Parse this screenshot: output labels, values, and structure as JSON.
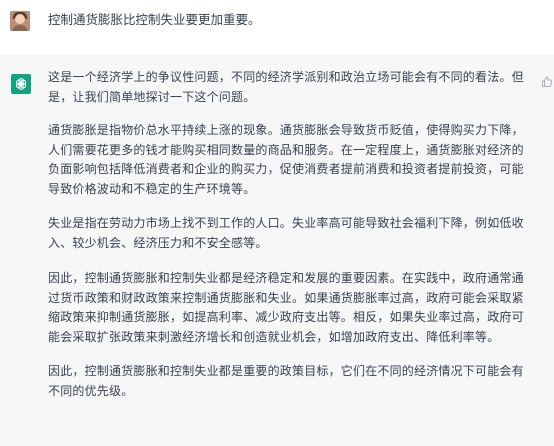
{
  "user_message": {
    "avatar": "user-avatar",
    "text": "控制通货膨胀比控制失业要更加重要。"
  },
  "assistant_message": {
    "avatar": "openai-logo-icon",
    "avatar_color": "#10a37f",
    "paragraphs": [
      "这是一个经济学上的争议性问题，不同的经济学派别和政治立场可能会有不同的看法。但是，让我们简单地探讨一下这个问题。",
      "通货膨胀是指物价总水平持续上涨的现象。通货膨胀会导致货币贬值，使得购买力下降，人们需要花更多的钱才能购买相同数量的商品和服务。在一定程度上，通货膨胀对经济的负面影响包括降低消费者和企业的购买力，促使消费者提前消费和投资者提前投资，可能导致价格波动和不稳定的生产环境等。",
      "失业是指在劳动力市场上找不到工作的人口。失业率高可能导致社会福利下降，例如低收入、较少机会、经济压力和不安全感等。",
      "因此，控制通货膨胀和控制失业都是经济稳定和发展的重要因素。在实践中，政府通常通过货币政策和财政政策来控制通货膨胀和失业。如果通货膨胀率过高，政府可能会采取紧缩政策来抑制通货膨胀，如提高利率、减少政府支出等。相反，如果失业率过高，政府可能会采取扩张政策来刺激经济增长和创造就业机会，如增加政府支出、降低利率等。",
      "因此，控制通货膨胀和控制失业都是重要的政策目标，它们在不同的经济情况下可能会有不同的优先级。"
    ]
  },
  "actions": {
    "like_icon": "thumbs-up-icon"
  }
}
